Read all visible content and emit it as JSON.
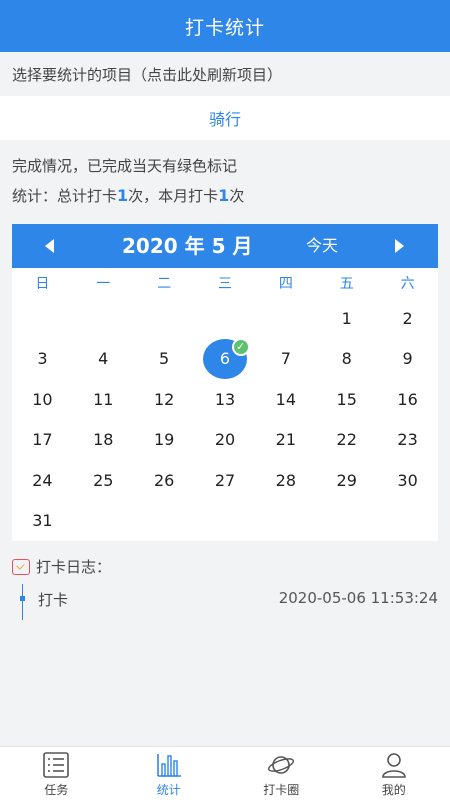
{
  "header": {
    "title": "打卡统计"
  },
  "hint": {
    "text": "选择要统计的项目（点击此处刷新项目）"
  },
  "project": {
    "name": "骑行"
  },
  "info": {
    "status_text": "完成情况，已完成当天有绿色标记",
    "stats_prefix": "统计：总计打卡",
    "total_count": "1",
    "stats_mid": "次，本月打卡",
    "month_count": "1",
    "stats_suffix": "次"
  },
  "calendar": {
    "month_label": "2020 年 5 月",
    "today_label": "今天",
    "weekdays": [
      "日",
      "一",
      "二",
      "三",
      "四",
      "五",
      "六"
    ],
    "leading_blanks": 5,
    "days": [
      "1",
      "2",
      "3",
      "4",
      "5",
      "6",
      "7",
      "8",
      "9",
      "10",
      "11",
      "12",
      "13",
      "14",
      "15",
      "16",
      "17",
      "18",
      "19",
      "20",
      "21",
      "22",
      "23",
      "24",
      "25",
      "26",
      "27",
      "28",
      "29",
      "30",
      "31"
    ],
    "selected_day": "6",
    "completed_days": [
      "6"
    ],
    "accent_color": "#2e86e8",
    "done_color": "#5cc26f"
  },
  "log": {
    "title": "打卡日志：",
    "items": [
      {
        "label": "打卡",
        "time": "2020-05-06 11:53:24"
      }
    ]
  },
  "tabbar": {
    "tabs": [
      {
        "label": "任务",
        "icon": "list-icon"
      },
      {
        "label": "统计",
        "icon": "bar-chart-icon",
        "active": true
      },
      {
        "label": "打卡圈",
        "icon": "planet-icon"
      },
      {
        "label": "我的",
        "icon": "user-icon"
      }
    ]
  }
}
